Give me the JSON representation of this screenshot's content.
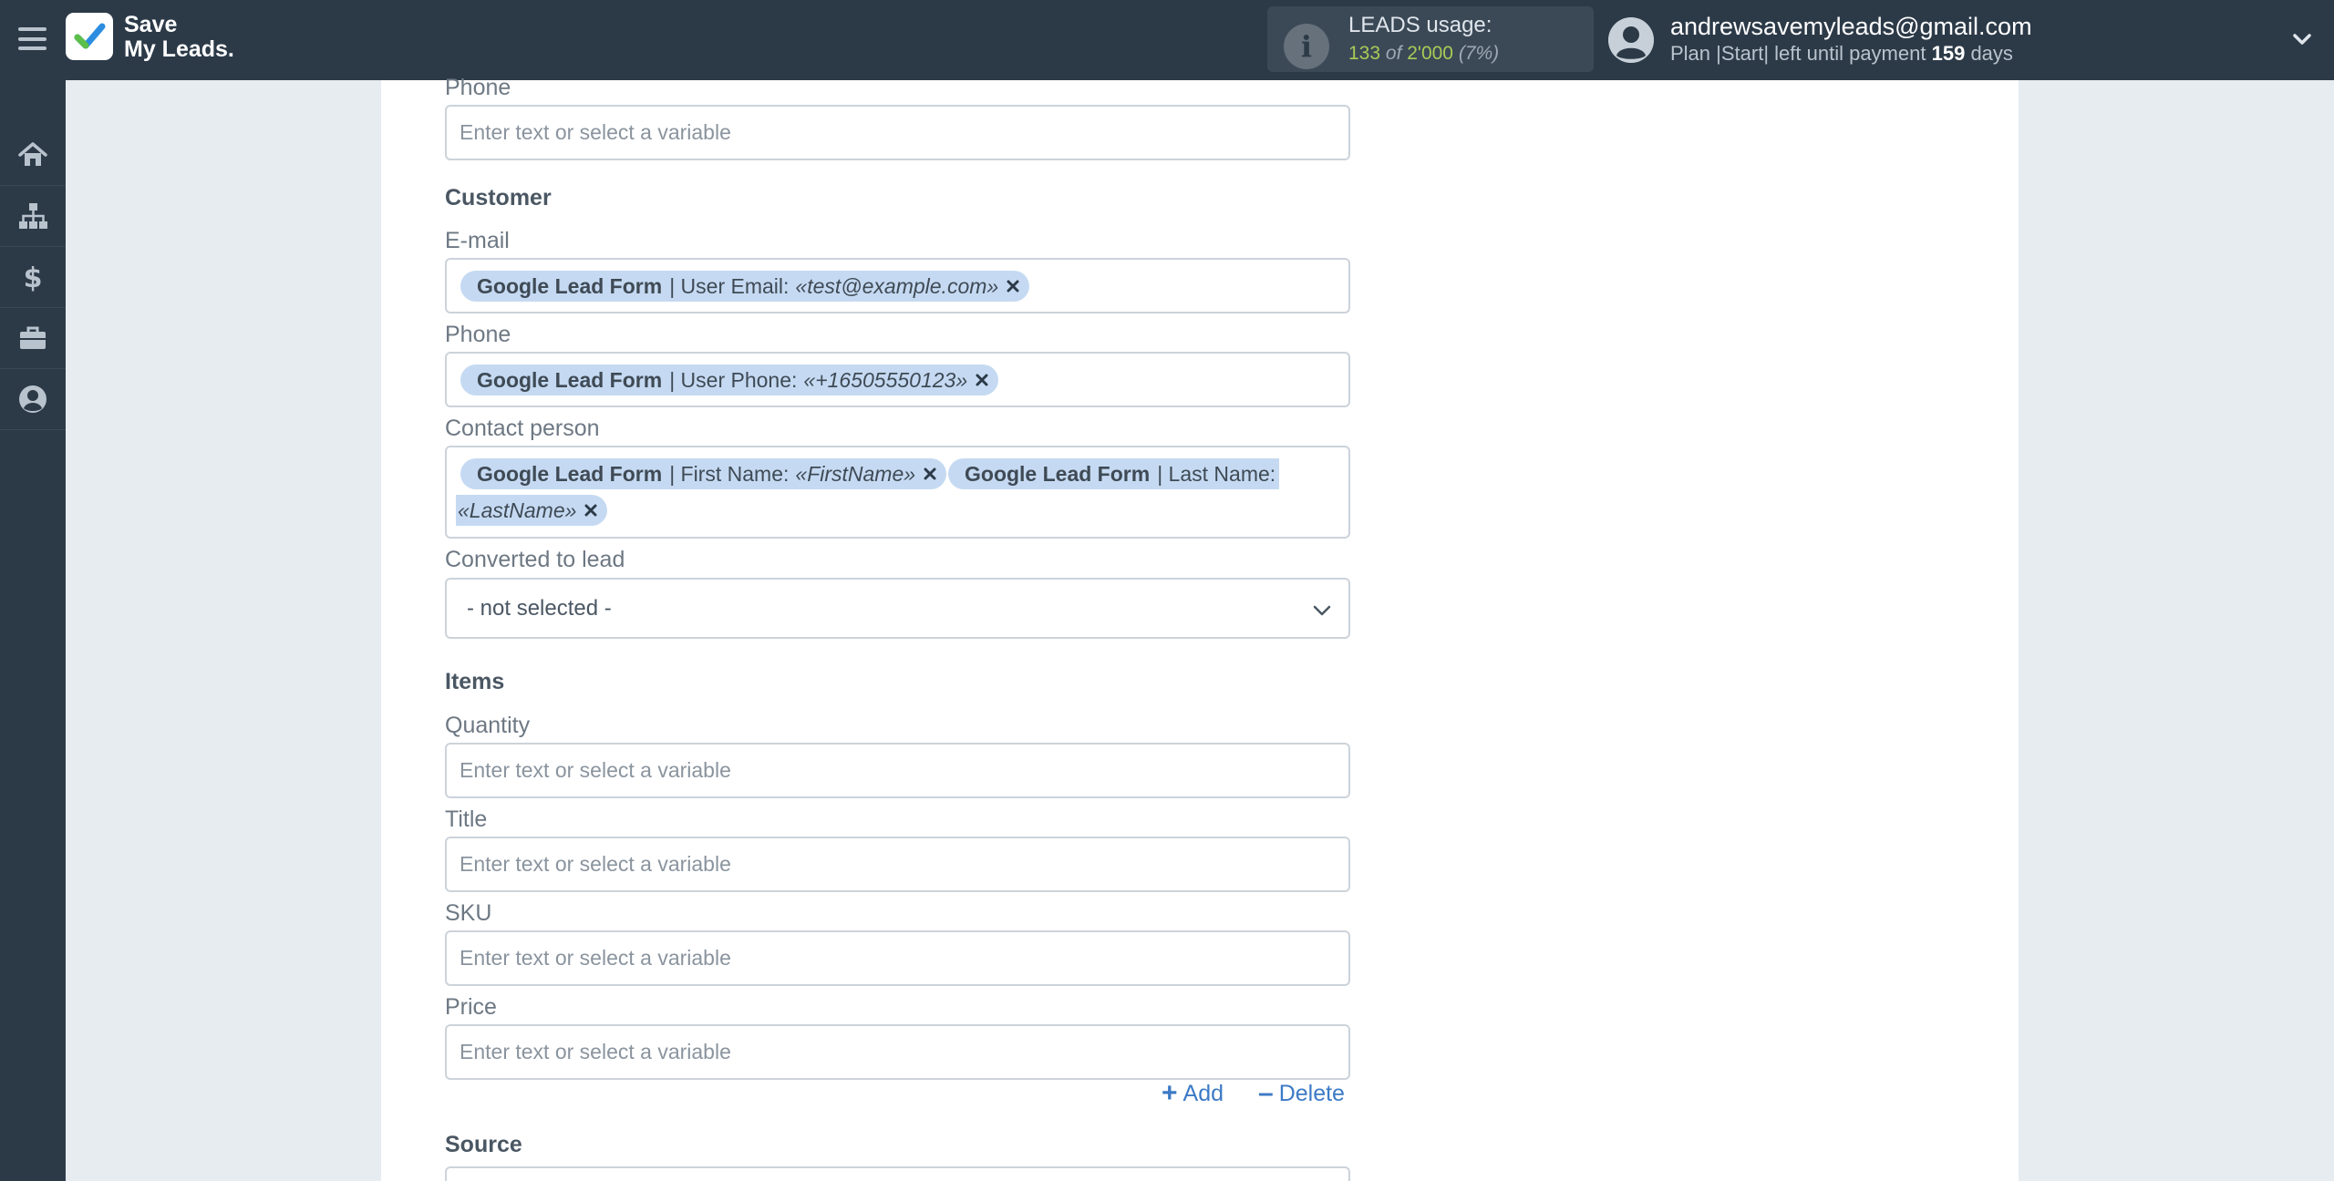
{
  "header": {
    "logo_line1": "Save",
    "logo_line2": "My Leads.",
    "usage_label": "LEADS usage:",
    "usage_used": "133",
    "usage_of": "of",
    "usage_total": "2'000",
    "usage_percent": "(7%)",
    "account_email": "andrewsavemyleads@gmail.com",
    "plan_prefix": "Plan |Start| left until payment",
    "plan_days": "159",
    "plan_suffix": "days"
  },
  "sidebar": {
    "items": [
      {
        "icon": "home-icon"
      },
      {
        "icon": "sitemap-icon"
      },
      {
        "icon": "dollar-icon"
      },
      {
        "icon": "briefcase-icon"
      },
      {
        "icon": "user-circle-icon"
      }
    ]
  },
  "form": {
    "phone_top_label": "Phone",
    "placeholder": "Enter text or select a variable",
    "customer_title": "Customer",
    "email_label": "E-mail",
    "email_chip": {
      "source": "Google Lead Form",
      "field": "| User Email:",
      "value": "«test@example.com»"
    },
    "phone_label": "Phone",
    "phone_chip": {
      "source": "Google Lead Form",
      "field": "| User Phone:",
      "value": "«+16505550123»"
    },
    "contact_label": "Contact person",
    "first_name_chip": {
      "source": "Google Lead Form",
      "field": "| First Name:",
      "value": "«FirstName»"
    },
    "last_name_chip": {
      "source": "Google Lead Form",
      "field": "| Last Name:",
      "value": "«LastName»"
    },
    "converted_label": "Converted to lead",
    "converted_value": "- not selected -",
    "items_title": "Items",
    "quantity_label": "Quantity",
    "title_label": "Title",
    "sku_label": "SKU",
    "price_label": "Price",
    "add_label": "Add",
    "delete_label": "Delete",
    "source_title": "Source"
  },
  "colors": {
    "topbar": "#2c3a48",
    "chip": "#c5daf2",
    "link": "#3c7ac6",
    "usage_green": "#a6cc56"
  }
}
